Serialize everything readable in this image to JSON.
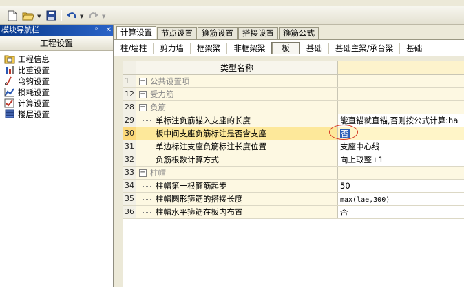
{
  "left_panel": {
    "title": "模块导航栏",
    "pin_glyph": "ᵖ",
    "close_glyph": "✕",
    "header": "工程设置",
    "items": [
      {
        "label": "工程信息",
        "icon": "folder-info-icon"
      },
      {
        "label": "比重设置",
        "icon": "weight-icon"
      },
      {
        "label": "弯钩设置",
        "icon": "hook-icon"
      },
      {
        "label": "损耗设置",
        "icon": "loss-chart-icon"
      },
      {
        "label": "计算设置",
        "icon": "calc-settings-icon"
      },
      {
        "label": "楼层设置",
        "icon": "floors-icon"
      }
    ]
  },
  "tabs": [
    "计算设置",
    "节点设置",
    "箍筋设置",
    "搭接设置",
    "箍筋公式"
  ],
  "active_tab": 0,
  "subtabs": [
    "柱/墙柱",
    "剪力墙",
    "框架梁",
    "非框架梁",
    "板",
    "基础",
    "基础主梁/承台梁",
    "基础"
  ],
  "active_subtab": 4,
  "grid": {
    "header_name": "类型名称",
    "rows": [
      {
        "num": "1",
        "type": "section",
        "name": "公共设置项",
        "expander": "+",
        "value": ""
      },
      {
        "num": "12",
        "type": "section",
        "name": "受力筋",
        "expander": "+",
        "value": ""
      },
      {
        "num": "28",
        "type": "section",
        "name": "负筋",
        "expander": "−",
        "value": ""
      },
      {
        "num": "29",
        "type": "child",
        "name": "单标注负筋锚入支座的长度",
        "value": "能直锚就直锚,否则按公式计算:ha"
      },
      {
        "num": "30",
        "type": "child",
        "name": "板中间支座负筋标注是否含支座",
        "value": "否",
        "selected": true
      },
      {
        "num": "31",
        "type": "child",
        "name": "单边标注支座负筋标注长度位置",
        "value": "支座中心线"
      },
      {
        "num": "32",
        "type": "child",
        "name": "负筋根数计算方式",
        "value": "向上取整+1"
      },
      {
        "num": "33",
        "type": "section",
        "name": "柱帽",
        "expander": "−",
        "value": ""
      },
      {
        "num": "34",
        "type": "child",
        "name": "柱帽第一根箍筋起步",
        "value": "50"
      },
      {
        "num": "35",
        "type": "child",
        "name": "柱帽圆形箍筋的搭接长度",
        "value": "max(lae,300)",
        "mono": true
      },
      {
        "num": "36",
        "type": "child",
        "name": "柱帽水平箍筋在板内布置",
        "value": "否",
        "last": true
      }
    ]
  },
  "colors": {
    "titlebar": "#0a3a8c",
    "selected_row": "#fde89a",
    "annotation_circle": "#d4331f",
    "selected_cell": "#2c5fb8"
  }
}
